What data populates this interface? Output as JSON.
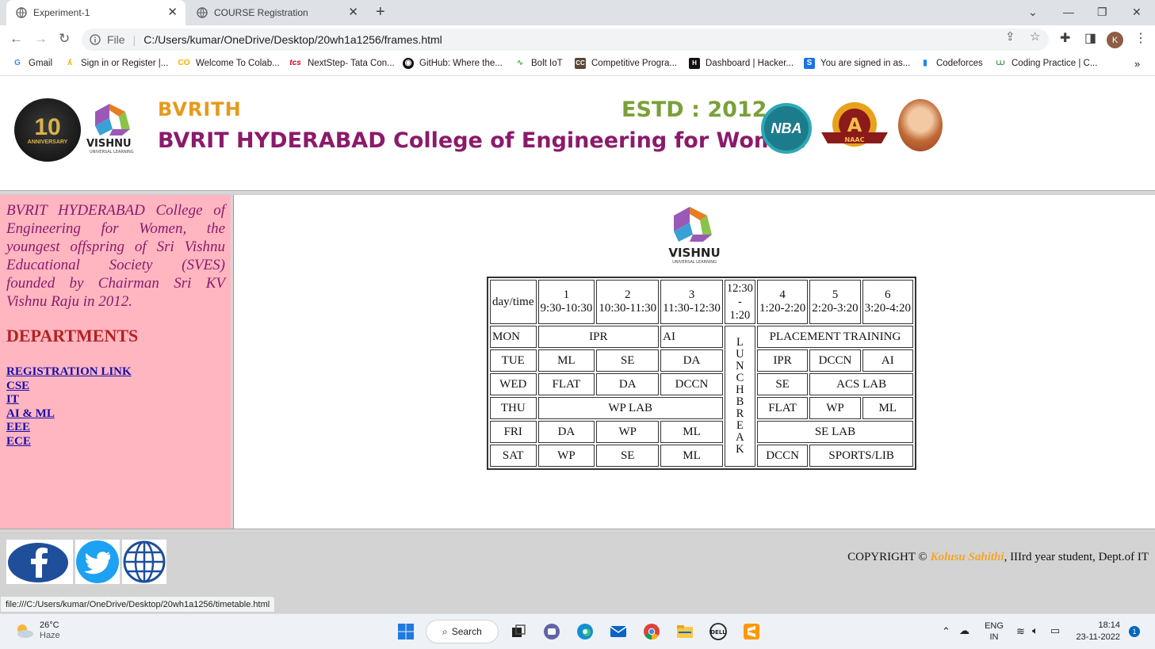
{
  "browser": {
    "tabs": [
      {
        "title": "Experiment-1",
        "active": true
      },
      {
        "title": "COURSE Registration",
        "active": false
      }
    ],
    "new_tab_label": "+",
    "window_controls": [
      "⌄",
      "—",
      "❐",
      "✕"
    ],
    "omnibox": {
      "scheme_label": "File",
      "url": "C:/Users/kumar/OneDrive/Desktop/20wh1a1256/frames.html"
    },
    "avatar_letter": "K",
    "bookmarks": [
      {
        "label": "Gmail",
        "icon": "gmail-icon"
      },
      {
        "label": "Sign in or Register |...",
        "icon": "eventbrite-icon"
      },
      {
        "label": "Welcome To Colab...",
        "icon": "colab-icon"
      },
      {
        "label": "NextStep- Tata Con...",
        "icon": "tcs-icon"
      },
      {
        "label": "GitHub: Where the...",
        "icon": "github-icon"
      },
      {
        "label": "Bolt IoT",
        "icon": "bolt-icon"
      },
      {
        "label": "Competitive Progra...",
        "icon": "codechef-icon"
      },
      {
        "label": "Dashboard | Hacker...",
        "icon": "hackerrank-icon"
      },
      {
        "label": "You are signed in as...",
        "icon": "s-icon"
      },
      {
        "label": "Codeforces",
        "icon": "codeforces-icon"
      },
      {
        "label": "Coding Practice | C...",
        "icon": "gfg-icon"
      }
    ],
    "bookmarks_overflow": "»",
    "status_url": "file:///C:/Users/kumar/OneDrive/Desktop/20wh1a1256/timetable.html"
  },
  "banner": {
    "anniversary_number": "10",
    "anniversary_text": "ANNIVERSARY",
    "vishnu_logo_text": "VISHNU",
    "vishnu_logo_subtext": "UNIVERSAL LEARNING",
    "short_name": "BVRITH",
    "estd": "ESTD : 2012",
    "college_name": "BVRIT HYDERABAD College of Engineering for Women",
    "nba_text": "NBA",
    "naac_grade": "A",
    "naac_text": "NAAC"
  },
  "sidebar": {
    "intro": "BVRIT HYDERABAD College of Engineering for Women, the youngest offspring of Sri Vishnu Educational Society (SVES) founded by Chairman Sri KV Vishnu Raju in 2012.",
    "departments_heading": "DEPARTMENTS",
    "links": [
      "REGISTRATION LINK",
      "CSE",
      "IT",
      "AI & ML",
      "EEE",
      "ECE"
    ]
  },
  "timetable": {
    "logo_text": "VISHNU",
    "logo_subtext": "UNIVERSAL LEARNING",
    "header": {
      "daytime": "day/time",
      "p1_num": "1",
      "p1_time": "9:30-10:30",
      "p2_num": "2",
      "p2_time": "10:30-11:30",
      "p3_num": "3",
      "p3_time": "11:30-12:30",
      "lunch_time_a": "12:30",
      "lunch_time_dash": "-",
      "lunch_time_b": "1:20",
      "p4_num": "4",
      "p4_time": "1:20-2:20",
      "p5_num": "5",
      "p5_time": "2:20-3:20",
      "p6_num": "6",
      "p6_time": "3:20-4:20"
    },
    "lunch_letters": [
      "L",
      "U",
      "N",
      "C",
      "H",
      "B",
      "R",
      "E",
      "A",
      "K"
    ],
    "mon": {
      "day": "MON",
      "p12": "IPR",
      "p3": "AI",
      "p456": "PLACEMENT TRAINING"
    },
    "tue": {
      "day": "TUE",
      "p1": "ML",
      "p2": "SE",
      "p3": "DA",
      "p4": "IPR",
      "p5": "DCCN",
      "p6": "AI"
    },
    "wed": {
      "day": "WED",
      "p1": "FLAT",
      "p2": "DA",
      "p3": "DCCN",
      "p4": "SE",
      "p56": "ACS LAB"
    },
    "thu": {
      "day": "THU",
      "p123": "WP LAB",
      "p4": "FLAT",
      "p5": "WP",
      "p6": "ML"
    },
    "fri": {
      "day": "FRI",
      "p1": "DA",
      "p2": "WP",
      "p3": "ML",
      "p456": "SE LAB"
    },
    "sat": {
      "day": "SAT",
      "p1": "WP",
      "p2": "SE",
      "p3": "ML",
      "p4": "DCCN",
      "p56": "SPORTS/LIB"
    }
  },
  "footer": {
    "copyright_prefix": "COPYRIGHT ©",
    "author": "Kolusu Sahithi",
    "copyright_suffix": ", IIIrd year student, Dept.of IT"
  },
  "taskbar": {
    "temperature": "26°C",
    "weather": "Haze",
    "search_label": "Search",
    "language": "ENG",
    "region": "IN",
    "time": "18:14",
    "date": "23-11-2022",
    "notifications": "1"
  },
  "colors": {
    "accent_purple": "#8b1a6b",
    "sidebar_pink": "#ffb6c1",
    "dept_red": "#b22222",
    "estd_green": "#7ba037",
    "bvrith_orange": "#e59a1d"
  }
}
